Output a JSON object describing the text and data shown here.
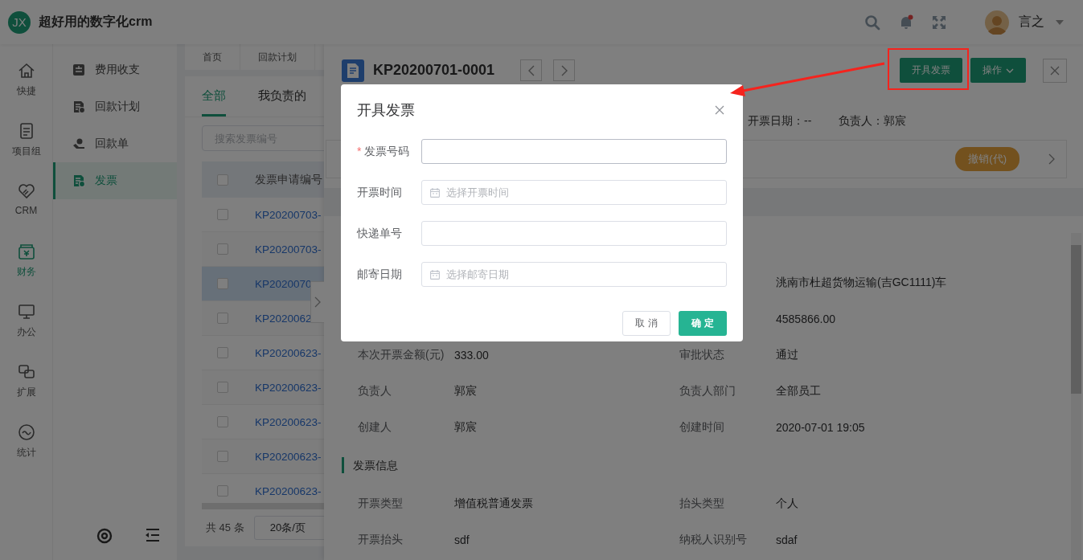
{
  "header": {
    "logo": "JX",
    "title": "超好用的数字化crm",
    "has_notification": true,
    "user_name": "言之"
  },
  "rail": [
    {
      "label": "快捷",
      "selected": false
    },
    {
      "label": "项目组",
      "selected": false
    },
    {
      "label": "CRM",
      "selected": false
    },
    {
      "label": "财务",
      "selected": true
    },
    {
      "label": "办公",
      "selected": false
    },
    {
      "label": "扩展",
      "selected": false
    },
    {
      "label": "统计",
      "selected": false
    }
  ],
  "submenu": [
    {
      "label": "费用收支",
      "selected": false
    },
    {
      "label": "回款计划",
      "selected": false
    },
    {
      "label": "回款单",
      "selected": false
    },
    {
      "label": "发票",
      "selected": true
    }
  ],
  "tags": [
    "首页",
    "回款计划"
  ],
  "list": {
    "tabs": [
      {
        "label": "全部",
        "selected": true
      },
      {
        "label": "我负责的",
        "selected": false
      }
    ],
    "search_placeholder": "搜索发票编号",
    "column": "发票申请编号",
    "all_checked": false,
    "rows": [
      {
        "number": "KP20200703-",
        "checked": false,
        "selected": false
      },
      {
        "number": "KP20200703-",
        "checked": false,
        "selected": false
      },
      {
        "number": "KP2020070",
        "checked": false,
        "selected": true
      },
      {
        "number": "KP2020062",
        "checked": false,
        "selected": false
      },
      {
        "number": "KP20200623-",
        "checked": false,
        "selected": false
      },
      {
        "number": "KP20200623-",
        "checked": false,
        "selected": false
      },
      {
        "number": "KP20200623-",
        "checked": false,
        "selected": false
      },
      {
        "number": "KP20200623-",
        "checked": false,
        "selected": false
      },
      {
        "number": "KP20200623-",
        "checked": false,
        "selected": false
      }
    ],
    "total": "共 45 条",
    "page_size": "20条/页"
  },
  "drawer": {
    "title": "KP20200701-0001",
    "primary_button": "开具发票",
    "menu_button": "操作",
    "meta": [
      {
        "label": "开票日期：",
        "value": "--"
      },
      {
        "label": "负责人：",
        "value": "郭宸"
      }
    ],
    "status_badge": "撤销(代)",
    "details": [
      {
        "right": {
          "value": "洮南市杜超货物运输(吉GC1111)车"
        }
      },
      {
        "right": {
          "value": "4585866.00"
        }
      },
      {
        "left": {
          "label": "本次开票金额(元)",
          "value": "333.00"
        },
        "right": {
          "label": "审批状态",
          "value": "通过"
        }
      },
      {
        "left": {
          "label": "负责人",
          "value": "郭宸"
        },
        "right": {
          "label": "负责人部门",
          "value": "全部员工"
        }
      },
      {
        "left": {
          "label": "创建人",
          "value": "郭宸"
        },
        "right": {
          "label": "创建时间",
          "value": "2020-07-01 19:05"
        }
      }
    ],
    "section": {
      "title": "发票信息",
      "rows": [
        {
          "left": {
            "label": "开票类型",
            "value": "增值税普通发票"
          },
          "right": {
            "label": "抬头类型",
            "value": "个人"
          }
        },
        {
          "left": {
            "label": "开票抬头",
            "value": "sdf"
          },
          "right": {
            "label": "纳税人识别号",
            "value": "sdaf"
          }
        }
      ]
    }
  },
  "dialog": {
    "title": "开具发票",
    "required_mark": "*",
    "fields": [
      {
        "kind": "text",
        "label": "发票号码",
        "required": true
      },
      {
        "kind": "date",
        "label": "开票时间",
        "required": false,
        "placeholder": "选择开票时间"
      },
      {
        "kind": "text",
        "label": "快递单号",
        "required": false
      },
      {
        "kind": "date",
        "label": "邮寄日期",
        "required": false,
        "placeholder": "选择邮寄日期"
      }
    ],
    "cancel": "取 消",
    "confirm": "确 定"
  }
}
